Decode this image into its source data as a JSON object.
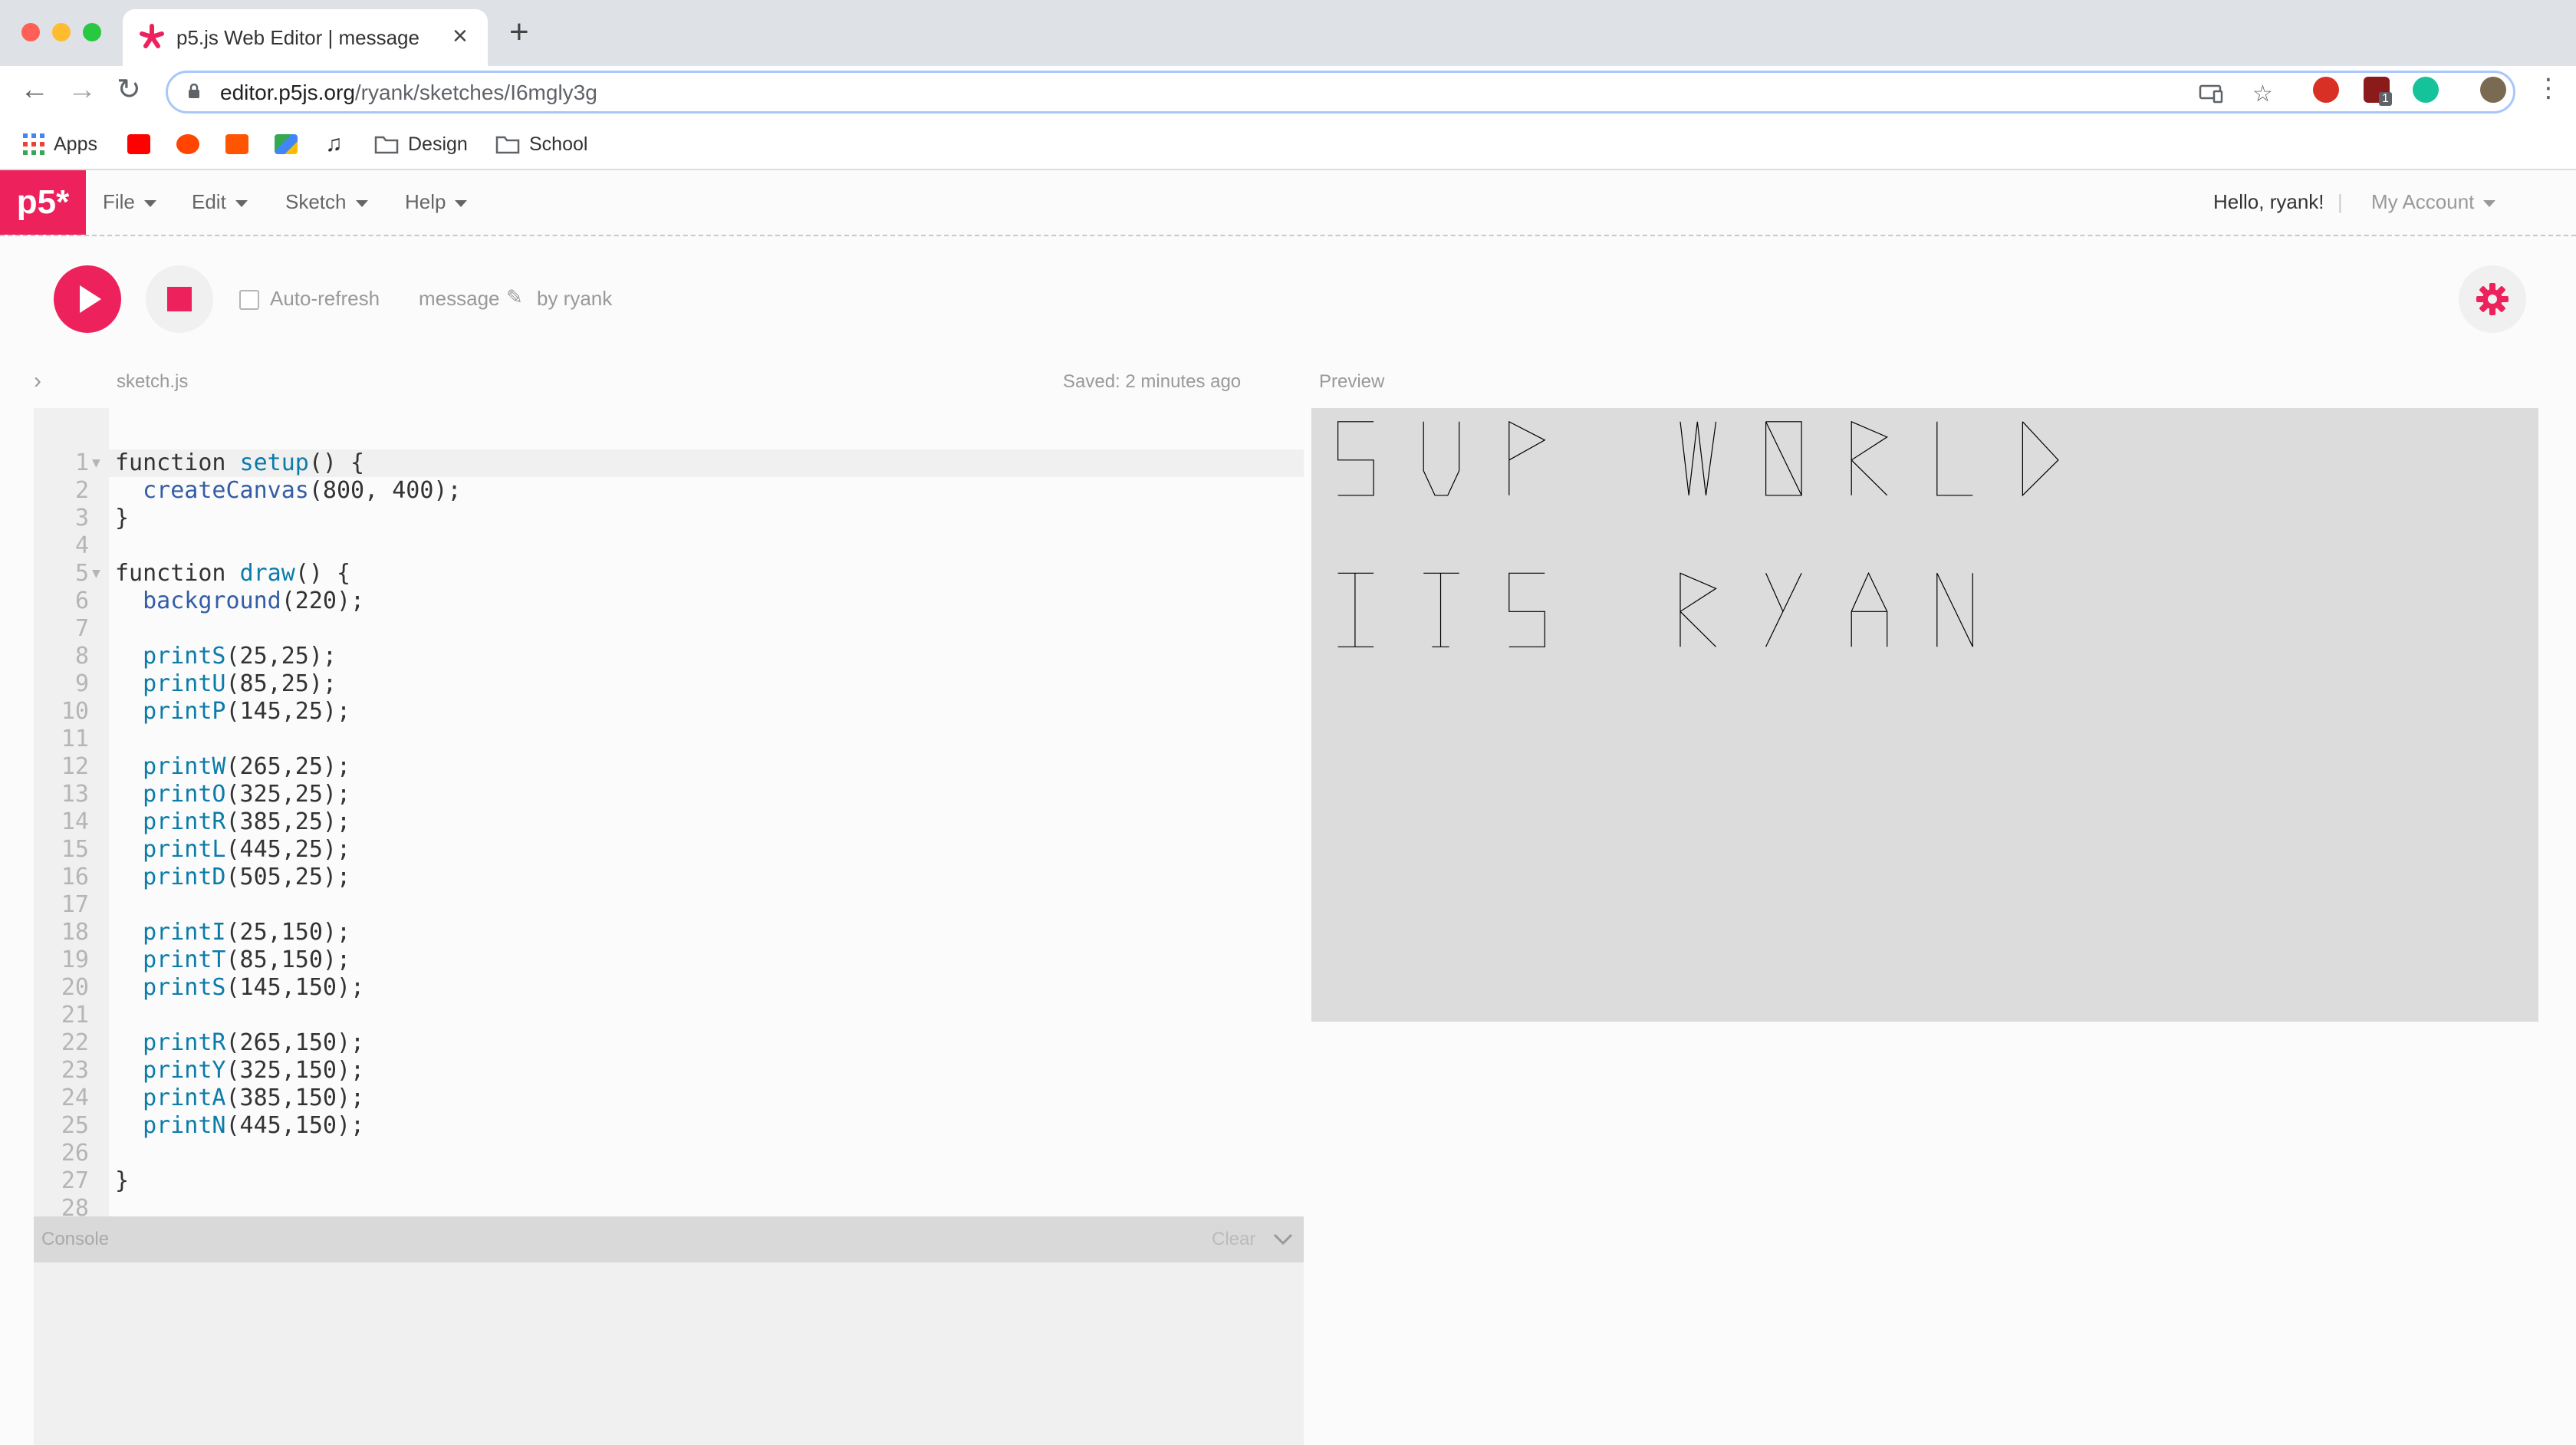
{
  "browser": {
    "tab_title": "p5.js Web Editor | message",
    "url_host": "editor.p5js.org",
    "url_path": "/ryank/sketches/I6mgly3g",
    "bookmarks": [
      "Apps",
      "Design",
      "School"
    ],
    "extension_badge": "1"
  },
  "editor_nav": {
    "logo": "p5*",
    "menu": [
      "File",
      "Edit",
      "Sketch",
      "Help"
    ],
    "greeting": "Hello, ryank!",
    "separator": "|",
    "account": "My Account"
  },
  "toolbar": {
    "auto_refresh_label": "Auto-refresh",
    "sketch_name": "message",
    "owner": "by ryank"
  },
  "file": {
    "name": "sketch.js",
    "saved_status": "Saved: 2 minutes ago"
  },
  "code_lines": [
    "function setup() {",
    "  createCanvas(800, 400);",
    "}",
    "",
    "function draw() {",
    "  background(220);",
    "",
    "  printS(25,25);",
    "  printU(85,25);",
    "  printP(145,25);",
    "",
    "  printW(265,25);",
    "  printO(325,25);",
    "  printR(385,25);",
    "  printL(445,25);",
    "  printD(505,25);",
    "",
    "  printI(25,150);",
    "  printT(85,150);",
    "  printS(145,150);",
    "",
    "  printR(265,150);",
    "  printY(325,150);",
    "  printA(385,150);",
    "  printN(445,150);",
    "",
    "}",
    ""
  ],
  "console": {
    "label": "Console",
    "clear_label": "Clear"
  },
  "preview": {
    "label": "Preview",
    "canvas_text": [
      "SUP WORLD",
      "ITS RYAN"
    ],
    "background": "#dcdcdc"
  },
  "colors": {
    "accent": "#ed225d"
  }
}
